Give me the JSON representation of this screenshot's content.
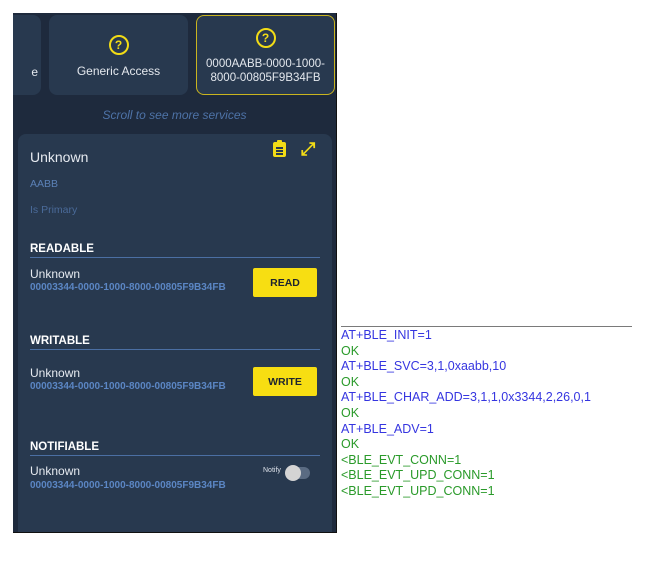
{
  "services_bar": {
    "partial_label": "e",
    "cards": [
      {
        "icon": "help-circle-icon",
        "label": "Generic Access"
      },
      {
        "icon": "help-circle-icon",
        "label": "0000AABB-0000-1000-8000-00805F9B34FB",
        "selected": true
      }
    ],
    "scroll_hint": "Scroll to see more services"
  },
  "service_detail": {
    "title": "Unknown",
    "uuid_short": "AABB",
    "primary_label": "Is Primary",
    "actions": {
      "copy_icon": "clipboard-icon",
      "expand_icon": "expand-icon"
    },
    "sections": [
      {
        "heading": "READABLE",
        "char_name": "Unknown",
        "char_uuid": "00003344-0000-1000-8000-00805F9B34FB",
        "button": "READ"
      },
      {
        "heading": "WRITABLE",
        "char_name": "Unknown",
        "char_uuid": "00003344-0000-1000-8000-00805F9B34FB",
        "button": "WRITE"
      },
      {
        "heading": "NOTIFIABLE",
        "char_name": "Unknown",
        "char_uuid": "00003344-0000-1000-8000-00805F9B34FB",
        "toggle_label": "Notify",
        "toggle_on": false
      }
    ]
  },
  "console": {
    "colors": {
      "command": "#3535e0",
      "response": "#2a9a2a"
    },
    "lines": [
      {
        "type": "cmd",
        "text": "AT+BLE_INIT=1"
      },
      {
        "type": "ok",
        "text": "OK"
      },
      {
        "type": "cmd",
        "text": "AT+BLE_SVC=3,1,0xaabb,10"
      },
      {
        "type": "ok",
        "text": "OK"
      },
      {
        "type": "cmd",
        "text": "AT+BLE_CHAR_ADD=3,1,1,0x3344,2,26,0,1"
      },
      {
        "type": "ok",
        "text": "OK"
      },
      {
        "type": "cmd",
        "text": "AT+BLE_ADV=1"
      },
      {
        "type": "ok",
        "text": "OK"
      },
      {
        "type": "evt",
        "text": "<BLE_EVT_CONN=1"
      },
      {
        "type": "evt",
        "text": "<BLE_EVT_UPD_CONN=1"
      },
      {
        "type": "evt",
        "text": "<BLE_EVT_UPD_CONN=1"
      }
    ]
  }
}
